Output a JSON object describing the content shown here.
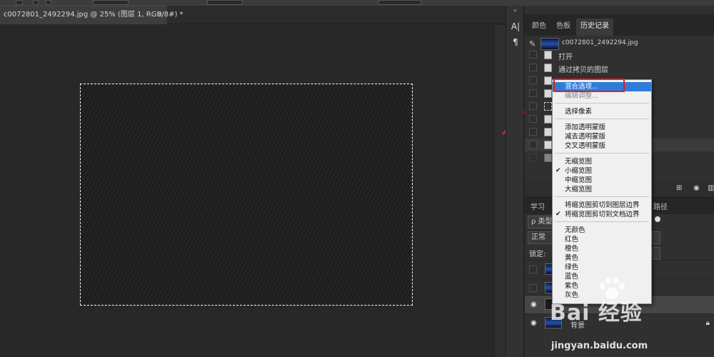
{
  "document_tab": {
    "title": "c0072801_2492294.jpg @ 25% (图层 1, RGB/8#) *",
    "close": "×"
  },
  "toolstrip": {
    "collapse": "«",
    "tool1": "A|",
    "tool2": "¶"
  },
  "panel_tabs": [
    "颜色",
    "色板",
    "历史记录"
  ],
  "history": {
    "snapshot_name": "c0072801_2492294.jpg",
    "steps": [
      "打开",
      "通过拷贝的图层",
      "通过拷贝的图层",
      "",
      "",
      "",
      "",
      "",
      ""
    ]
  },
  "layers_tabs": [
    "学习",
    "路径"
  ],
  "layers": {
    "filter_label": "ρ 类型",
    "blend_mode": "正常",
    "lock_label": "锁定:",
    "background_layer_name": "背景"
  },
  "context_menu": {
    "group1": [
      "混合选项...",
      "编辑调整..."
    ],
    "group2": [
      "选择像素"
    ],
    "group3": [
      "添加透明蒙版",
      "减去透明蒙版",
      "交叉透明蒙版"
    ],
    "group4": [
      "无缩览图",
      "小缩览图",
      "中缩览图",
      "大缩览图"
    ],
    "group5": [
      "将缩览图剪切到图层边界",
      "将缩览图剪切到文档边界"
    ],
    "group6": [
      "无颜色",
      "红色",
      "橙色",
      "黄色",
      "绿色",
      "蓝色",
      "紫色",
      "灰色"
    ]
  },
  "watermark": {
    "brand": "Bai 经验",
    "url": "jingyan.baidu.com"
  },
  "colors": {
    "highlight": "#2f7bd8",
    "annotation_red": "#e02020",
    "canvas": "#1f1f1f",
    "panel": "#303030"
  }
}
